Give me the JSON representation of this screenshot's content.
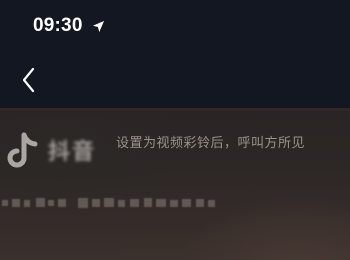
{
  "status_bar": {
    "time": "09:30",
    "location_icon": "location-arrow-icon"
  },
  "nav_bar": {
    "back_icon": "chevron-left-icon"
  },
  "video": {
    "app_logo_icon": "tiktok-logo-icon",
    "app_name": "抖音",
    "hint": "设置为视频彩铃后，呼叫方所见"
  },
  "colors": {
    "background": "#121721",
    "text_primary": "#ffffff",
    "hint_text": "#9a918c"
  }
}
